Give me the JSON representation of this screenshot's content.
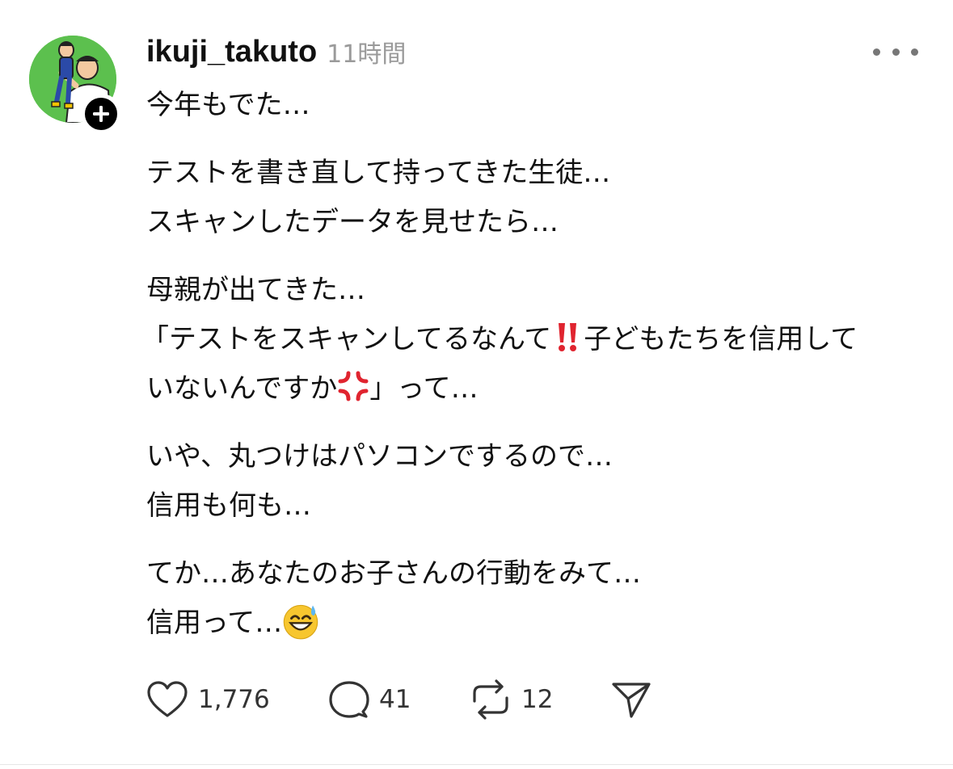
{
  "post": {
    "username": "ikuji_takuto",
    "timestamp": "11時間",
    "paragraphs": [
      {
        "lines": [
          "今年もでた…"
        ]
      },
      {
        "lines": [
          "テストを書き直して持ってきた生徒…",
          "スキャンしたデータを見せたら…"
        ]
      },
      {
        "line1": "母親が出てきた…",
        "line2_a": "「テストをスキャンしてるなんて",
        "line2_b": "子どもたちを信用して",
        "line3_a": "いないんですか",
        "line3_b": "」って…"
      },
      {
        "lines": [
          "いや、丸つけはパソコンでするので…",
          "信用も何も…"
        ]
      },
      {
        "line1": "てか…あなたのお子さんの行動をみて…",
        "line2": "信用って…"
      }
    ],
    "emojis": {
      "exclamation": "double-exclamation-icon",
      "anger": "anger-symbol-icon",
      "sweat_smile": "sweat-smile-icon"
    },
    "actions": {
      "likes": "1,776",
      "replies": "41",
      "reposts": "12"
    }
  },
  "colors": {
    "avatar_bg": "#5cc04e",
    "text": "#111111",
    "muted": "#9a9a9a",
    "emoji_red": "#e0242f"
  }
}
